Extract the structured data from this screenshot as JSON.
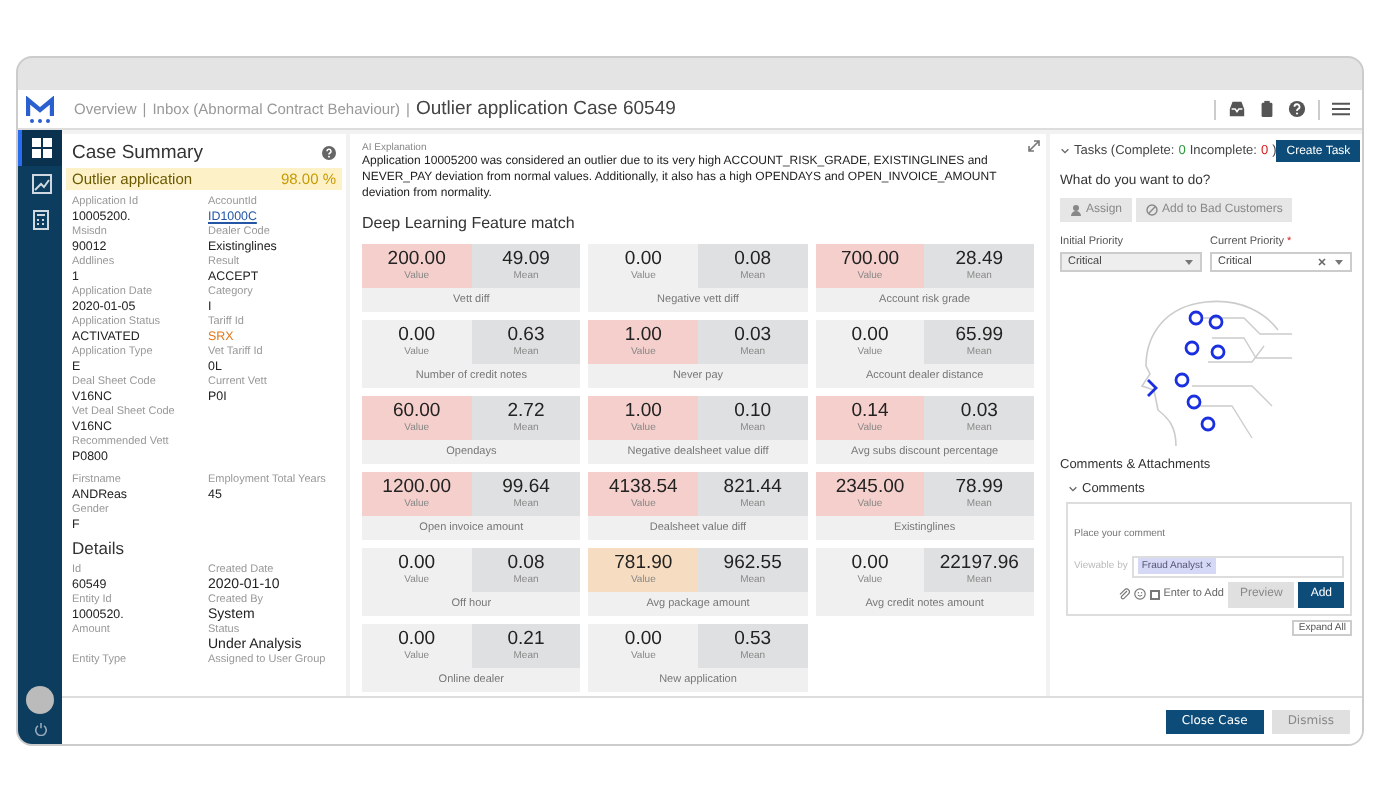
{
  "breadcrumb": [
    {
      "label": "Overview",
      "kind": "link"
    },
    {
      "label": "|",
      "kind": "separator"
    },
    {
      "label": "Inbox (Abnormal Contract Behaviour)",
      "kind": "link"
    },
    {
      "label": "|",
      "kind": "separator"
    },
    {
      "label": "Outlier application Case 60549",
      "kind": "current"
    }
  ],
  "sidebar": {
    "items": [
      {
        "selected": true
      },
      {
        "selected": false
      },
      {
        "selected": false
      }
    ]
  },
  "case_summary": {
    "title": "Case Summary",
    "outlier": {
      "label": "Outlier application",
      "score": "98.00 %"
    },
    "columns": [
      [
        {
          "label": "Application Id",
          "value": "10005200."
        },
        {
          "label": "Msisdn",
          "value": "90012"
        },
        {
          "label": "Addlines",
          "value": "1"
        },
        {
          "label": "Application Date",
          "value": "2020-01-05"
        },
        {
          "label": "Application Status",
          "value": "ACTIVATED"
        },
        {
          "label": "Application Type",
          "value": "E"
        },
        {
          "label": "Deal Sheet Code",
          "value": "V16NC"
        },
        {
          "label": "Vet Deal Sheet Code",
          "value": "V16NC"
        },
        {
          "label": "Recommended Vett",
          "value": "P0800"
        }
      ],
      [
        {
          "label": "AccountId",
          "value": "ID1000C",
          "kind": "link"
        },
        {
          "label": "Dealer Code",
          "value": "Existinglines"
        },
        {
          "label": "Result",
          "value": "ACCEPT"
        },
        {
          "label": "Category",
          "value": "I"
        },
        {
          "label": "Tariff Id",
          "value": "SRX",
          "kind": "accent"
        },
        {
          "label": "Vet Tariff Id",
          "value": "0L"
        },
        {
          "label": "Current Vett",
          "value": "P0I"
        }
      ]
    ],
    "person": [
      [
        {
          "label": "Firstname",
          "value": "ANDReas"
        },
        {
          "label": "Gender",
          "value": "F"
        }
      ],
      [
        {
          "label": "Employment Total Years",
          "value": "45"
        }
      ]
    ],
    "details_title": "Details",
    "details": [
      [
        {
          "label": "Id",
          "value": "60549"
        },
        {
          "label": "Entity Id",
          "value": "1000520."
        },
        {
          "label": "Amount"
        },
        {
          "label": "Entity Type"
        }
      ],
      [
        {
          "label": "Created Date",
          "value": "2020-01-10",
          "kind": "strong"
        },
        {
          "label": "Created By",
          "value": "System",
          "kind": "strong"
        },
        {
          "label": "Status",
          "value": "Under Analysis",
          "kind": "strong"
        },
        {
          "label": "Assigned to User Group"
        }
      ]
    ]
  },
  "explanation": {
    "label": "AI Explanation",
    "text": "Application 10005200 was considered an outlier due to its very high ACCOUNT_RISK_GRADE, EXISTINGLINES and NEVER_PAY deviation from normal values. Additionally, it also has a high OPENDAYS and OPEN_INVOICE_AMOUNT deviation from normality."
  },
  "features": {
    "title": "Deep Learning Feature match",
    "cards": [
      {
        "name": "Vett diff",
        "value": "200.00",
        "value_label": "Value",
        "mean": "49.09",
        "mean_label": "Mean",
        "kind": "high"
      },
      {
        "name": "Negative vett diff",
        "value": "0.00",
        "value_label": "Value",
        "mean": "0.08",
        "mean_label": "Mean",
        "kind": "normal"
      },
      {
        "name": "Account risk grade",
        "value": "700.00",
        "value_label": "Value",
        "mean": "28.49",
        "mean_label": "Mean",
        "kind": "high"
      },
      {
        "name": "Number of credit notes",
        "value": "0.00",
        "value_label": "Value",
        "mean": "0.63",
        "mean_label": "Mean",
        "kind": "normal"
      },
      {
        "name": "Never pay",
        "value": "1.00",
        "value_label": "Value",
        "mean": "0.03",
        "mean_label": "Mean",
        "kind": "high"
      },
      {
        "name": "Account dealer distance",
        "value": "0.00",
        "value_label": "Value",
        "mean": "65.99",
        "mean_label": "Mean",
        "kind": "normal"
      },
      {
        "name": "Opendays",
        "value": "60.00",
        "value_label": "Value",
        "mean": "2.72",
        "mean_label": "Mean",
        "kind": "high"
      },
      {
        "name": "Negative dealsheet value diff",
        "value": "1.00",
        "value_label": "Value",
        "mean": "0.10",
        "mean_label": "Mean",
        "kind": "high"
      },
      {
        "name": "Avg subs discount percentage",
        "value": "0.14",
        "value_label": "Value",
        "mean": "0.03",
        "mean_label": "Mean",
        "kind": "high"
      },
      {
        "name": "Open invoice amount",
        "value": "1200.00",
        "value_label": "Value",
        "mean": "99.64",
        "mean_label": "Mean",
        "kind": "high"
      },
      {
        "name": "Dealsheet value diff",
        "value": "4138.54",
        "value_label": "Value",
        "mean": "821.44",
        "mean_label": "Mean",
        "kind": "high"
      },
      {
        "name": "Existinglines",
        "value": "2345.00",
        "value_label": "Value",
        "mean": "78.99",
        "mean_label": "Mean",
        "kind": "high"
      },
      {
        "name": "Off hour",
        "value": "0.00",
        "value_label": "Value",
        "mean": "0.08",
        "mean_label": "Mean",
        "kind": "normal"
      },
      {
        "name": "Avg package amount",
        "value": "781.90",
        "value_label": "Value",
        "mean": "962.55",
        "mean_label": "Mean",
        "kind": "medium"
      },
      {
        "name": "Avg credit notes amount",
        "value": "0.00",
        "value_label": "Value",
        "mean": "22197.96",
        "mean_label": "Mean",
        "kind": "normal"
      },
      {
        "name": "Online dealer",
        "value": "0.00",
        "value_label": "Value",
        "mean": "0.21",
        "mean_label": "Mean",
        "kind": "normal"
      },
      {
        "name": "New application",
        "value": "0.00",
        "value_label": "Value",
        "mean": "0.53",
        "mean_label": "Mean",
        "kind": "normal"
      }
    ]
  },
  "tasks": {
    "expanded": true,
    "prefix": "Tasks (Complete:",
    "complete": "0",
    "middle": "Incomplete:",
    "incomplete": "0",
    "suffix": ")",
    "create_button": "Create Task"
  },
  "actions": {
    "title": "What do you want to do?",
    "buttons": [
      {
        "label": "Assign"
      },
      {
        "label": "Add to Bad Customers"
      }
    ]
  },
  "priorities": [
    {
      "label": "Initial Priority",
      "value": "Critical",
      "clearable": false
    },
    {
      "label": "Current Priority",
      "required_mark": "*",
      "value": "Critical",
      "clearable": true
    }
  ],
  "comments": {
    "title": "Comments & Attachments",
    "section": "Comments",
    "expanded": true,
    "placeholder": "Place your comment",
    "viewable_label": "Viewable by",
    "tags": [
      {
        "label": "Fraud Analyst",
        "remove": "×"
      }
    ],
    "enter_to_add": {
      "label": "Enter to Add",
      "checked": false
    },
    "preview_button": "Preview",
    "add_button": "Add",
    "expand_all": "Expand All"
  },
  "footer": {
    "buttons": [
      {
        "label": "Close Case",
        "disabled": false
      },
      {
        "label": "Dismiss",
        "disabled": true
      }
    ]
  }
}
